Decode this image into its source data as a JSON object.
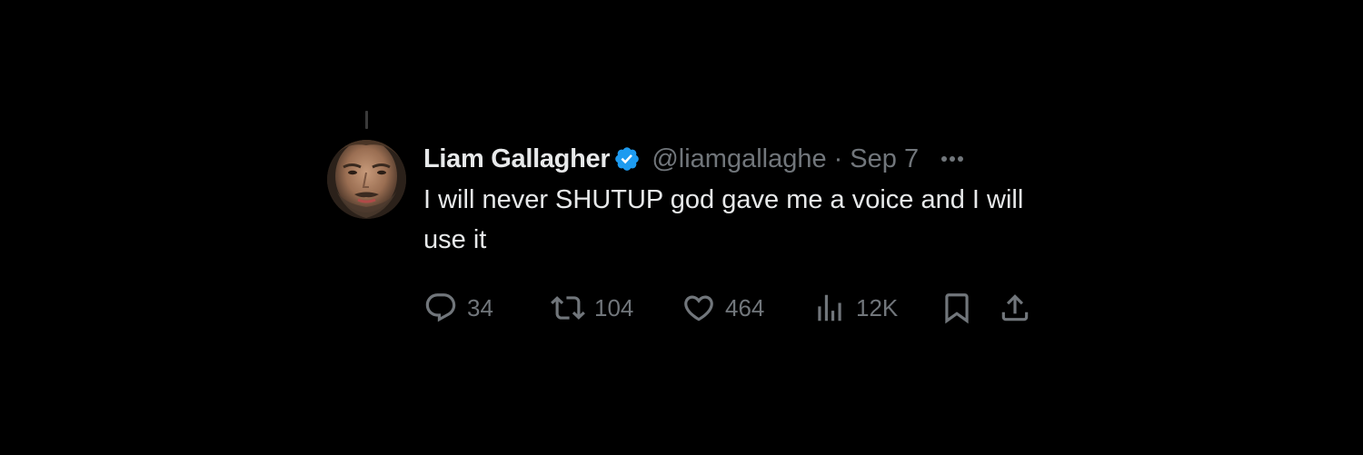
{
  "tweet": {
    "display_name": "Liam Gallagher",
    "handle": "@liamgallaghe",
    "separator": "·",
    "date": "Sep 7",
    "text": "I will never SHUTUP god gave me a voice and I will use it",
    "verified": true,
    "verified_color": "#1d9bf0"
  },
  "actions": {
    "reply": {
      "icon": "reply-icon",
      "count": "34"
    },
    "retweet": {
      "icon": "retweet-icon",
      "count": "104"
    },
    "like": {
      "icon": "heart-icon",
      "count": "464"
    },
    "views": {
      "icon": "views-icon",
      "count": "12K"
    },
    "bookmark": {
      "icon": "bookmark-icon"
    },
    "share": {
      "icon": "share-icon"
    }
  },
  "colors": {
    "background": "#000000",
    "primary_text": "#e7e9ea",
    "secondary_text": "#71767b"
  }
}
